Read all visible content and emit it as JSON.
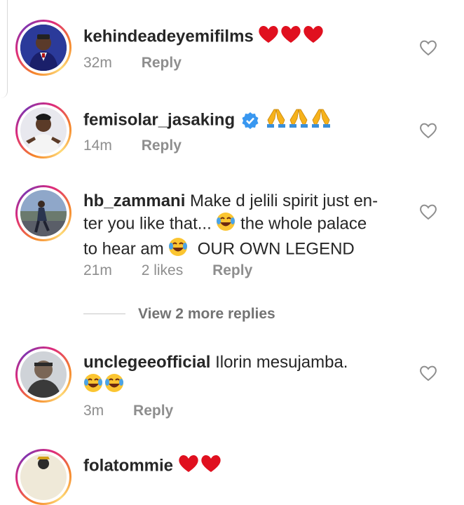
{
  "comments": [
    {
      "username": "kehindeadeyemifilms",
      "text": "",
      "emoji_after": "❤❤❤",
      "time": "32m",
      "likes": "",
      "reply": "Reply"
    },
    {
      "username": "femisolar_jasaking",
      "text": "",
      "emoji_after": "🙏🙏🙏",
      "time": "14m",
      "likes": "",
      "reply": "Reply"
    },
    {
      "username": "hb_zammani",
      "text_1": "Make d jelili spirit just en-",
      "text_2": "ter you like that...",
      "text_3": "the whole palace",
      "text_4": "to hear am",
      "text_5": "OUR OWN LEGEND",
      "time": "21m",
      "likes": "2 likes",
      "reply": "Reply"
    },
    {
      "username": "unclegeeofficial",
      "text": "Ilorin mesujamba.",
      "time": "3m",
      "likes": "",
      "reply": "Reply"
    },
    {
      "username": "folatommie",
      "text": ""
    }
  ],
  "view_more_replies": "View 2 more replies",
  "colors": {
    "heart": "#e0101f",
    "verified": "#3897f0",
    "ring_start": "#f58529",
    "ring_end": "#dd2a7b"
  }
}
